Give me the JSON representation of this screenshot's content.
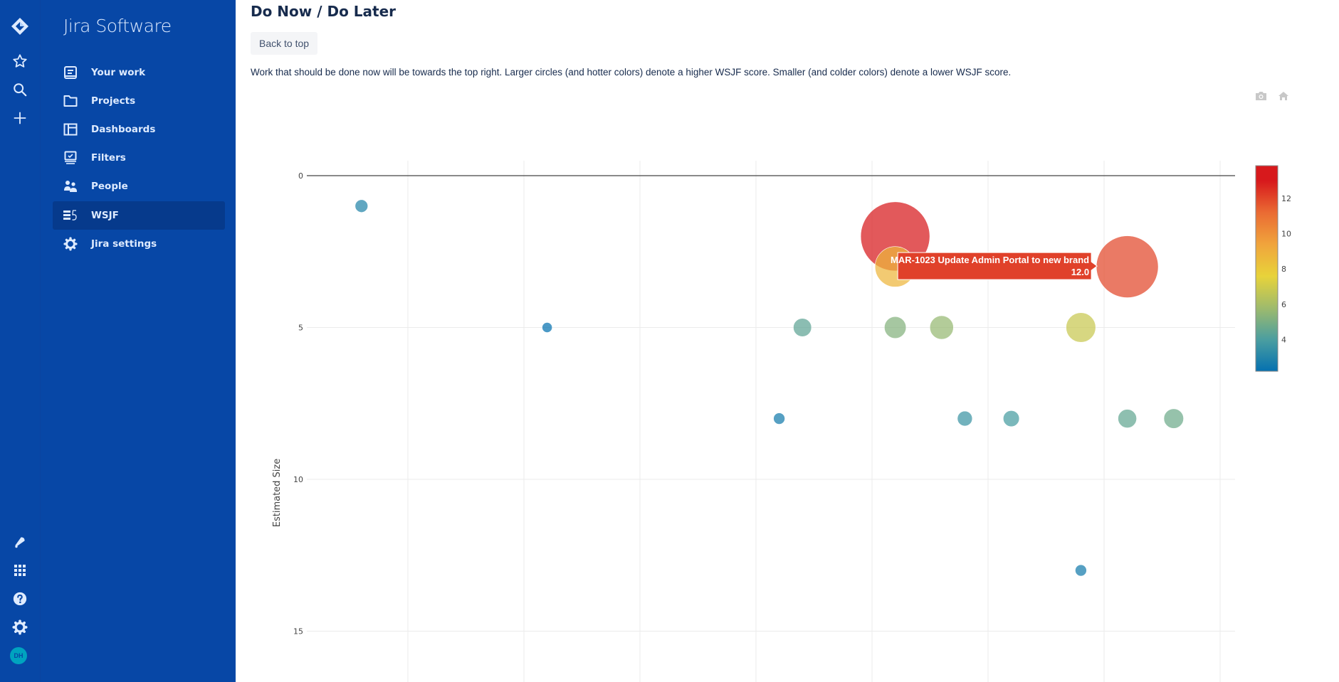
{
  "global_nav": {
    "top_icons": [
      "jira-logo-icon",
      "star-icon",
      "search-icon",
      "plus-icon"
    ],
    "bottom_icons": [
      "notifications-icon",
      "app-switcher-icon",
      "help-icon",
      "settings-icon"
    ],
    "avatar_initials": "DH"
  },
  "sidebar": {
    "product_title": "Jira Software",
    "items": [
      {
        "label": "Your work",
        "icon": "your-work-icon",
        "active": false
      },
      {
        "label": "Projects",
        "icon": "folder-icon",
        "active": false
      },
      {
        "label": "Dashboards",
        "icon": "dashboard-icon",
        "active": false
      },
      {
        "label": "Filters",
        "icon": "filter-icon",
        "active": false
      },
      {
        "label": "People",
        "icon": "people-icon",
        "active": false
      },
      {
        "label": "WSJF",
        "icon": "wsjf-icon",
        "active": true
      },
      {
        "label": "Jira settings",
        "icon": "settings-icon",
        "active": false
      }
    ]
  },
  "main": {
    "title": "Do Now / Do Later",
    "back_to_top_label": "Back to top",
    "description": "Work that should be done now will be towards the top right. Larger circles (and hotter colors) denote a higher WSJF score. Smaller (and colder colors) denote a lower WSJF score.",
    "modebar": [
      "camera-icon",
      "home-icon"
    ]
  },
  "tooltip": {
    "title": "MAR-1023 Update Admin Portal to new brand",
    "value": "12.0",
    "color": "#e0412a"
  },
  "chart_data": {
    "type": "scatter",
    "title": "",
    "xlabel": "",
    "ylabel": "Estimated Size",
    "x_gridlines": [
      5,
      10,
      15,
      20,
      25,
      30,
      35,
      40
    ],
    "xlim": [
      0.6,
      40.7
    ],
    "ylim": [
      16.5,
      -0.5
    ],
    "y_reversed": true,
    "y_ticks": [
      0,
      5,
      10,
      15
    ],
    "grid": true,
    "marker_size_by": "wsjf",
    "marker_color_by": "wsjf",
    "colorbar": {
      "ticks": [
        4,
        6,
        8,
        10,
        12
      ],
      "range": [
        2.2,
        13
      ],
      "colorscale": [
        "#0571b0",
        "#4b9ea0",
        "#9fbb6c",
        "#e8d33a",
        "#f0a43c",
        "#ea6b33",
        "#d7191c"
      ],
      "placement": "right"
    },
    "points": [
      {
        "x": 3,
        "y": 1,
        "wsjf": 3.0
      },
      {
        "x": 11,
        "y": 5,
        "wsjf": 2.2
      },
      {
        "x": 21,
        "y": 8,
        "wsjf": 2.6
      },
      {
        "x": 22,
        "y": 5,
        "wsjf": 4.4
      },
      {
        "x": 26,
        "y": 2,
        "wsjf": 13.0
      },
      {
        "x": 26,
        "y": 3,
        "wsjf": 8.7
      },
      {
        "x": 26,
        "y": 5,
        "wsjf": 5.2
      },
      {
        "x": 28,
        "y": 5,
        "wsjf": 5.6
      },
      {
        "x": 29,
        "y": 8,
        "wsjf": 3.6
      },
      {
        "x": 31,
        "y": 8,
        "wsjf": 3.9
      },
      {
        "x": 34,
        "y": 5,
        "wsjf": 6.8
      },
      {
        "x": 34,
        "y": 13,
        "wsjf": 2.6
      },
      {
        "x": 36,
        "y": 8,
        "wsjf": 4.5
      },
      {
        "x": 36,
        "y": 3,
        "wsjf": 12.0,
        "label": "MAR-1023 Update Admin Portal to new brand"
      },
      {
        "x": 38,
        "y": 8,
        "wsjf": 4.75
      }
    ]
  }
}
